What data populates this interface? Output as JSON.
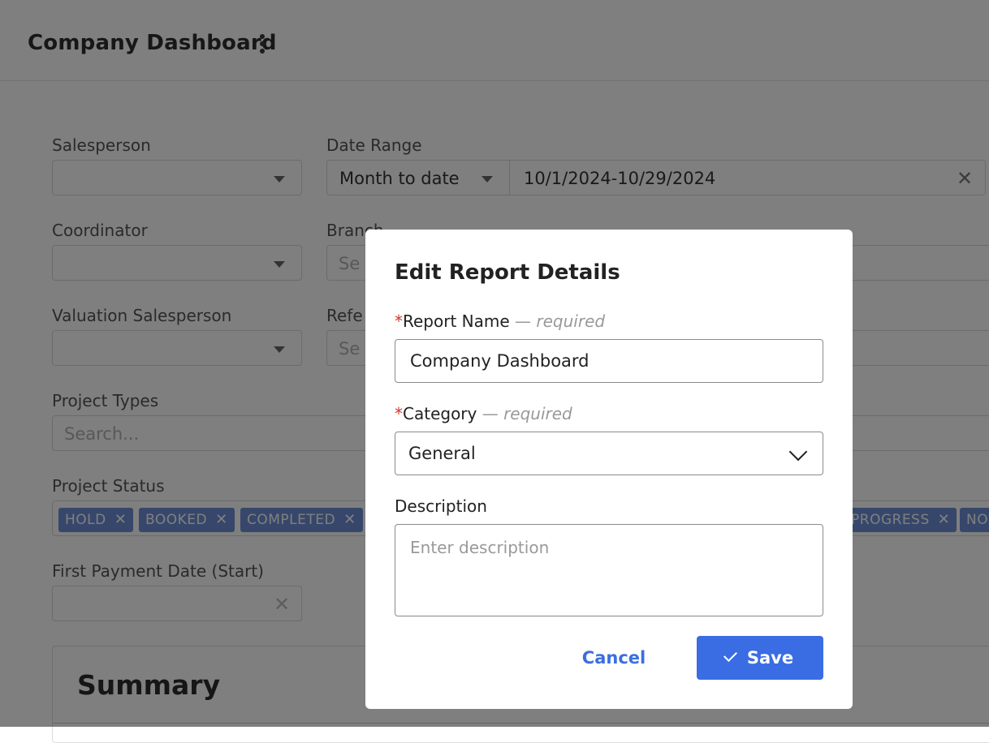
{
  "header": {
    "title": "Company Dashboard",
    "menu_icon": "kebab-vertical-icon"
  },
  "filters": {
    "salesperson": {
      "label": "Salesperson",
      "value": ""
    },
    "date_range": {
      "label": "Date Range",
      "preset": "Month to date",
      "value": "10/1/2024-10/29/2024"
    },
    "coordinator": {
      "label": "Coordinator",
      "value": ""
    },
    "branch": {
      "label": "Branch",
      "placeholder": "Se"
    },
    "valuation_salesperson": {
      "label": "Valuation Salesperson",
      "value": ""
    },
    "referral": {
      "label": "Refe",
      "placeholder": "Se"
    },
    "project_types": {
      "label": "Project Types",
      "placeholder": "Search..."
    },
    "project_status": {
      "label": "Project Status",
      "tags": [
        "HOLD",
        "BOOKED",
        "COMPLETED",
        "PROGRESS",
        "NO"
      ]
    },
    "first_payment_date": {
      "label": "First Payment Date (Start)",
      "value": ""
    }
  },
  "summary": {
    "title": "Summary"
  },
  "modal": {
    "title": "Edit Report Details",
    "report_name": {
      "star": "*",
      "label": "Report Name",
      "hint": "— required",
      "value": "Company Dashboard"
    },
    "category": {
      "star": "*",
      "label": "Category",
      "hint": "— required",
      "value": "General"
    },
    "description": {
      "label": "Description",
      "placeholder": "Enter description"
    },
    "cancel_label": "Cancel",
    "save_label": "Save"
  },
  "colors": {
    "accent": "#3a6de3",
    "tag": "#6e8fd6",
    "required": "#d0342c"
  }
}
